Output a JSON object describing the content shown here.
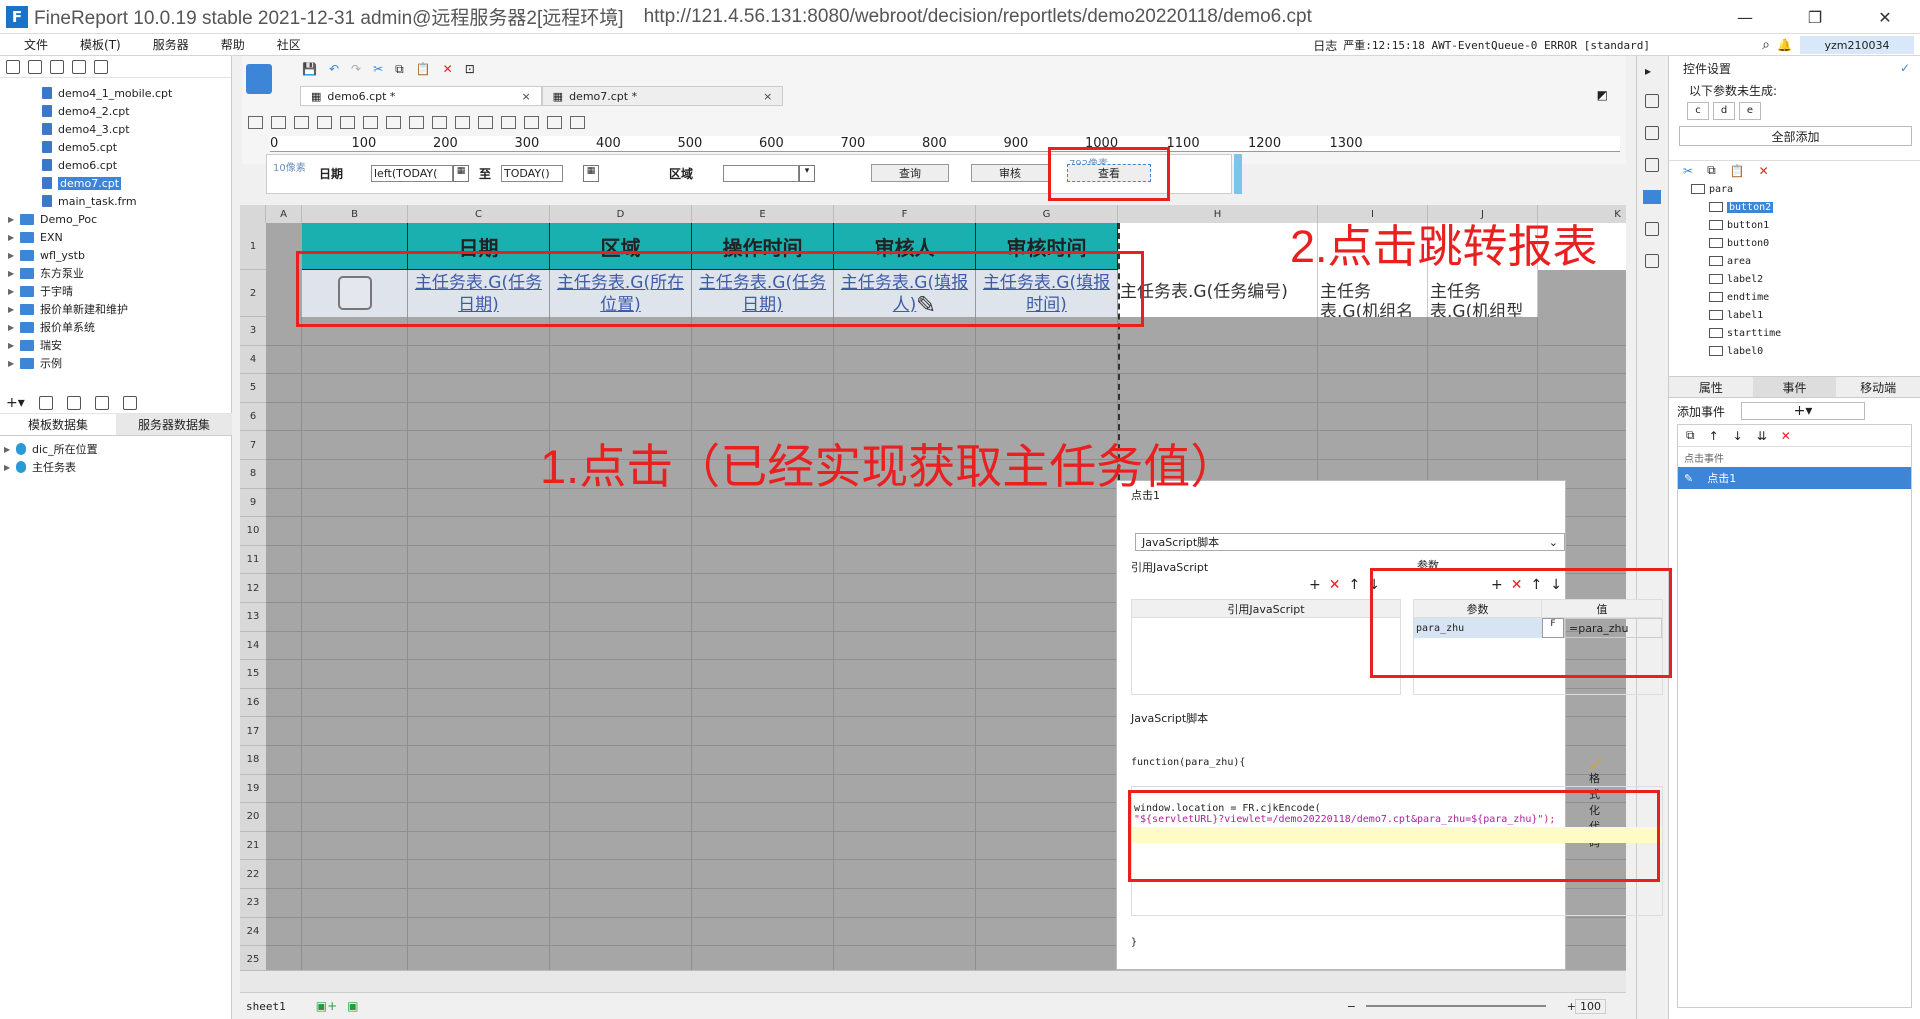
{
  "window": {
    "title": "FineReport 10.0.19 stable 2021-12-31 admin@远程服务器2[远程环境]",
    "url": "http://121.4.56.131:8080/webroot/decision/reportlets/demo20220118/demo6.cpt"
  },
  "menubar": {
    "items": [
      "文件",
      "模板(T)",
      "服务器",
      "帮助",
      "社区"
    ],
    "log_label": "日志",
    "log_status": "严重:12:15:18 AWT-EventQueue-0 ERROR [standard]",
    "user": "yzm210034"
  },
  "lefttree": {
    "items": [
      {
        "label": "demo4_1_mobile.cpt",
        "kind": "file"
      },
      {
        "label": "demo4_2.cpt",
        "kind": "file"
      },
      {
        "label": "demo4_3.cpt",
        "kind": "file"
      },
      {
        "label": "demo5.cpt",
        "kind": "file"
      },
      {
        "label": "demo6.cpt",
        "kind": "file"
      },
      {
        "label": "demo7.cpt",
        "kind": "file",
        "selected": true
      },
      {
        "label": "main_task.frm",
        "kind": "file"
      },
      {
        "label": "Demo_Poc",
        "kind": "folder"
      },
      {
        "label": "EXN",
        "kind": "folder"
      },
      {
        "label": "wfl_ystb",
        "kind": "folder"
      },
      {
        "label": "东方泵业",
        "kind": "folder"
      },
      {
        "label": "于宇晴",
        "kind": "folder"
      },
      {
        "label": "报价单新建和维护",
        "kind": "folder"
      },
      {
        "label": "报价单系统",
        "kind": "folder"
      },
      {
        "label": "瑞安",
        "kind": "folder"
      },
      {
        "label": "示例",
        "kind": "folder"
      }
    ]
  },
  "datasets": {
    "tabs": [
      "模板数据集",
      "服务器数据集"
    ],
    "items": [
      "dic_所在位置",
      "主任务表"
    ]
  },
  "editor": {
    "tabs": [
      {
        "label": "demo6.cpt *",
        "close": "×"
      },
      {
        "label": "demo7.cpt *",
        "close": "×"
      }
    ],
    "ruler": [
      "0",
      "100",
      "200",
      "300",
      "400",
      "500",
      "600",
      "700",
      "800",
      "900",
      "1000",
      "1100",
      "1200",
      "1300"
    ],
    "ruler_units": [
      "10像素",
      "792像素"
    ]
  },
  "parampane": {
    "date_label": "日期",
    "date_from": "left(TODAY(",
    "to_label": "至",
    "date_to": "TODAY()",
    "area_label": "区域",
    "btn_query": "查询",
    "btn_audit": "审核",
    "btn_view": "查看"
  },
  "grid": {
    "columns": [
      "A",
      "B",
      "C",
      "D",
      "E",
      "F",
      "G",
      "H",
      "I",
      "J",
      "K"
    ],
    "rows": [
      "1",
      "2",
      "3",
      "4",
      "5",
      "6",
      "7",
      "8",
      "9",
      "10",
      "11",
      "12",
      "13",
      "14",
      "15",
      "16",
      "17",
      "18",
      "19",
      "20",
      "21",
      "22",
      "23",
      "24",
      "25"
    ],
    "headers": [
      "日期",
      "区域",
      "操作时间",
      "审核人",
      "审核时间"
    ],
    "row2": [
      "主任务表.G(任务日期)",
      "主任务表.G(所在位置)",
      "主任务表.G(任务日期)",
      "主任务表.G(填报人)",
      "主任务表.G(填报时间)"
    ],
    "row2_extra": [
      "主任务表.G(任务编号)",
      "主任务表.G(机组名称)",
      "主任务表.G(机组型号)"
    ]
  },
  "sheetbar": {
    "sheet": "sheet1",
    "zoom": "100"
  },
  "rightpanel": {
    "title": "控件设置",
    "not_generated": "以下参数未生成:",
    "params": [
      "c",
      "d",
      "e"
    ],
    "add_all": "全部添加",
    "widgets": [
      "para",
      "button2",
      "button1",
      "button0",
      "area",
      "label2",
      "endtime",
      "label1",
      "starttime",
      "label0"
    ],
    "tabs": [
      "属性",
      "事件",
      "移动端"
    ],
    "add_event": "添加事件",
    "event_group": "点击事件",
    "event_item": "点击1"
  },
  "eventdlg": {
    "title": "点击1",
    "type": "JavaScript脚本",
    "ref_js_title": "引用JavaScript",
    "ref_js_col": "引用JavaScript",
    "param_title": "参数",
    "param_col": "参数",
    "value_col": "值",
    "param_name": "para_zhu",
    "param_value": "=para_zhu",
    "js_title": "JavaScript脚本",
    "func_sig": "function(para_zhu){",
    "format_btn": "格式化代码",
    "code_line1": "window.location = FR.cjkEncode(",
    "code_line2": "\"${servletURL}?viewlet=/demo20220118/demo7.cpt&para_zhu=${para_zhu}\");",
    "func_end": "}"
  },
  "annotations": {
    "step1": "1.点击（已经实现获取主任务值）",
    "step2": "2.点击跳转报表",
    "color": "#e82020"
  }
}
